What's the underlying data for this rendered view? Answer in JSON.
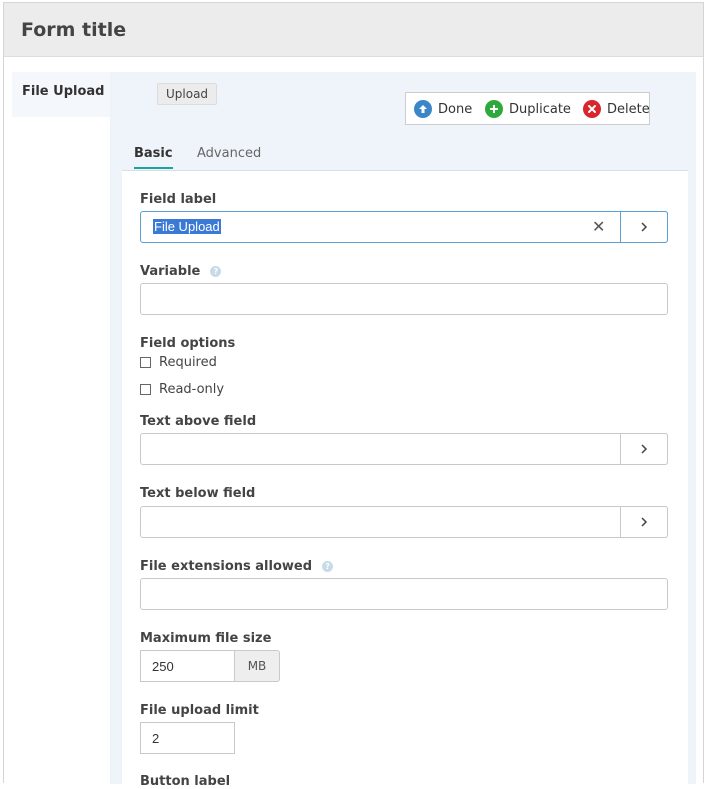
{
  "header": {
    "title": "Form title"
  },
  "field_list": {
    "selected_item": "File Upload"
  },
  "editor": {
    "type_badge": "Upload",
    "actions": {
      "done": "Done",
      "duplicate": "Duplicate",
      "delete": "Delete"
    },
    "tabs": {
      "basic": "Basic",
      "advanced": "Advanced"
    },
    "fields": {
      "field_label": {
        "label": "Field label",
        "value": "File Upload"
      },
      "variable": {
        "label": "Variable",
        "value": ""
      },
      "field_options": {
        "label": "Field options",
        "required": "Required",
        "read_only": "Read-only"
      },
      "text_above": {
        "label": "Text above field",
        "value": ""
      },
      "text_below": {
        "label": "Text below field",
        "value": ""
      },
      "file_extensions": {
        "label": "File extensions allowed",
        "value": ""
      },
      "max_file_size": {
        "label": "Maximum file size",
        "value": "250",
        "unit": "MB"
      },
      "upload_limit": {
        "label": "File upload limit",
        "value": "2"
      },
      "button_label": {
        "label": "Button label"
      }
    }
  },
  "colors": {
    "done": "#3b86c8",
    "duplicate": "#2eaa3c",
    "delete": "#d9262c",
    "tab_accent": "#1aa3a0"
  }
}
